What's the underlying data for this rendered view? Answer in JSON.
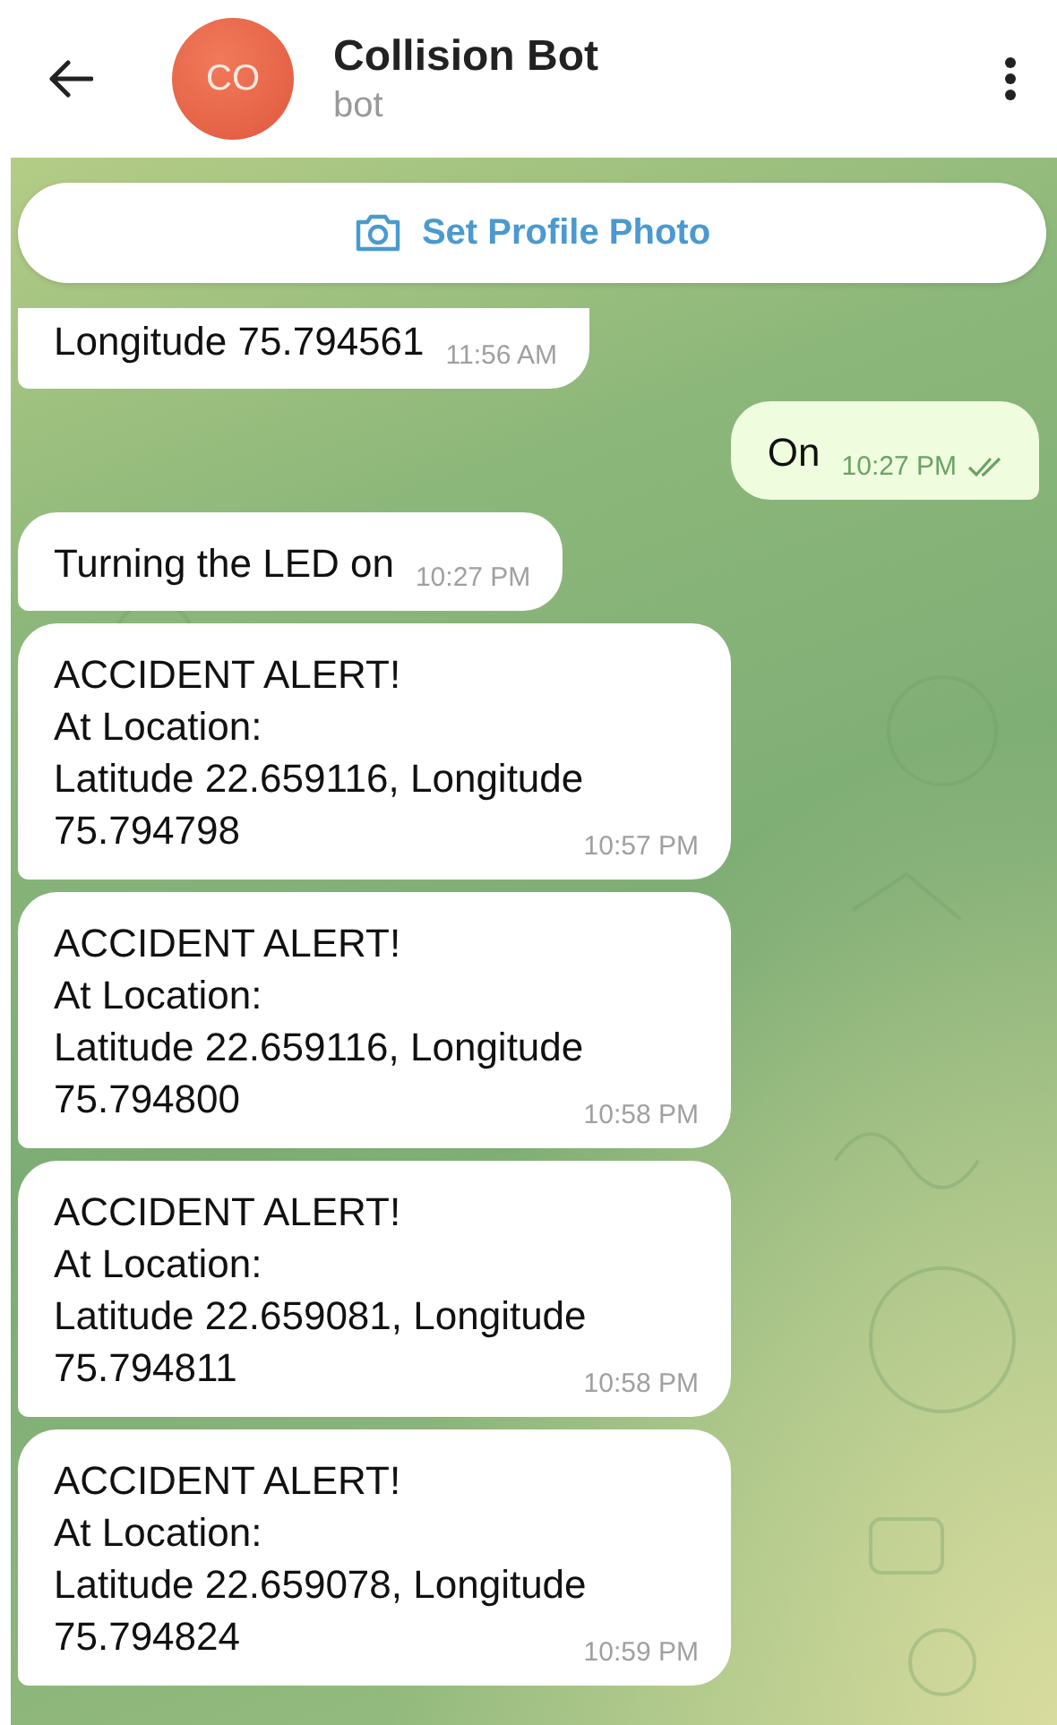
{
  "header": {
    "avatar_initials": "CO",
    "title": "Collision Bot",
    "subtitle": "bot"
  },
  "banner": {
    "label": "Set Profile Photo"
  },
  "messages": [
    {
      "kind": "incoming",
      "text": "Longitude 75.794561",
      "time": "11:56 AM",
      "clipped": true
    },
    {
      "kind": "outgoing",
      "text": "On",
      "time": "10:27 PM",
      "read": true
    },
    {
      "kind": "incoming",
      "text": "Turning the LED on",
      "time": "10:27 PM"
    },
    {
      "kind": "incoming",
      "text": "ACCIDENT ALERT!\nAt Location:\nLatitude 22.659116, Longitude\n75.794798",
      "time": "10:57 PM"
    },
    {
      "kind": "incoming",
      "text": "ACCIDENT ALERT!\nAt Location:\nLatitude 22.659116, Longitude\n75.794800",
      "time": "10:58 PM"
    },
    {
      "kind": "incoming",
      "text": "ACCIDENT ALERT!\nAt Location:\nLatitude 22.659081, Longitude\n75.794811",
      "time": "10:58 PM"
    },
    {
      "kind": "incoming",
      "text": "ACCIDENT ALERT!\nAt Location:\nLatitude 22.659078, Longitude\n75.794824",
      "time": "10:59 PM"
    }
  ]
}
